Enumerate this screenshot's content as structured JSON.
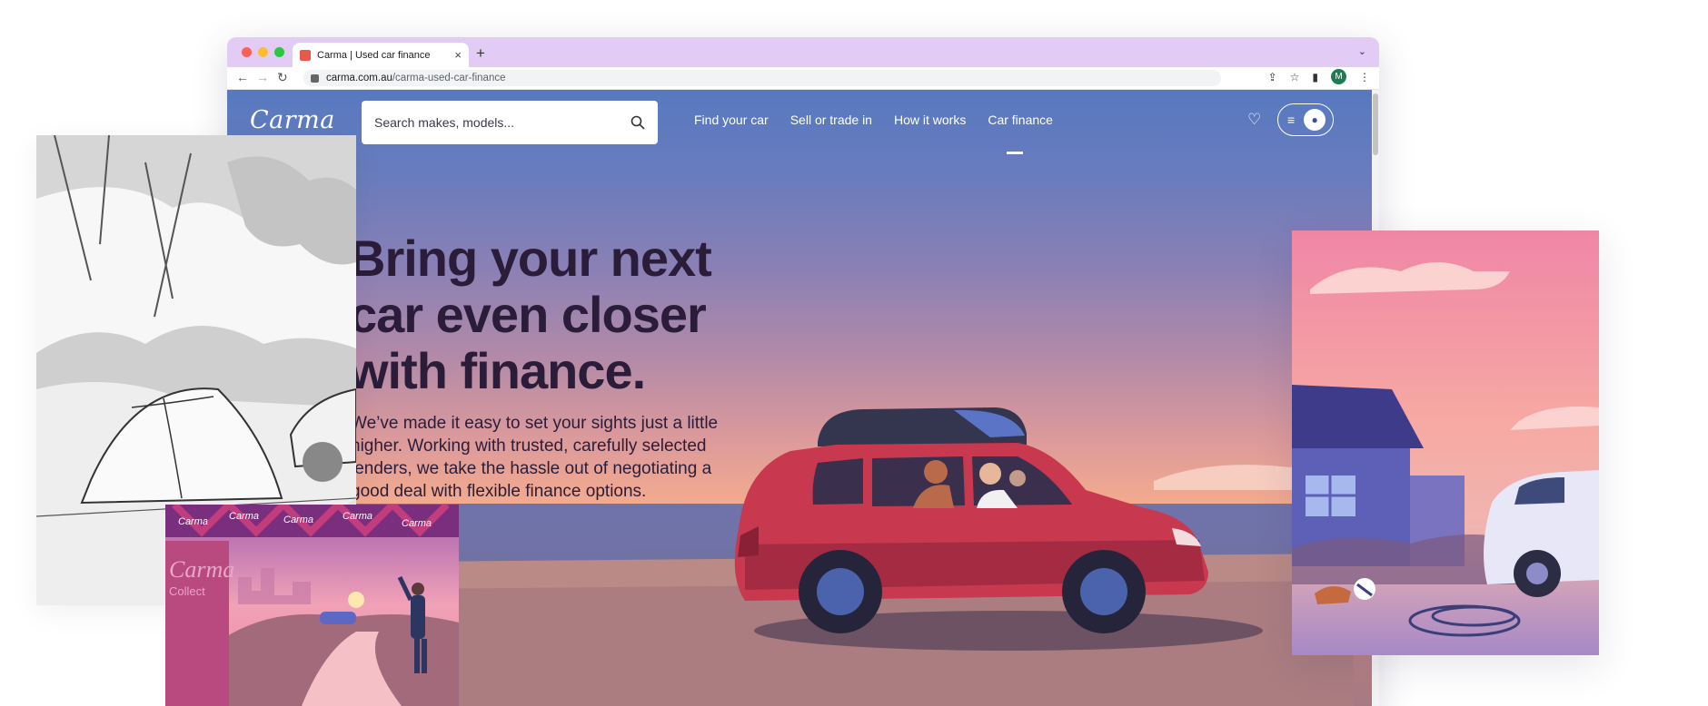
{
  "browser": {
    "tab_title": "Carma | Used car finance",
    "url_host": "carma.com.au",
    "url_path": "/carma-used-car-finance",
    "profile_initial": "M",
    "new_tab_label": "+",
    "tab_close_label": "×"
  },
  "site": {
    "logo": "Carma",
    "search_placeholder": "Search makes, models...",
    "nav": [
      "Find your car",
      "Sell or trade in",
      "How it works",
      "Car finance"
    ],
    "active_nav": "Car finance"
  },
  "hero": {
    "title_lines": [
      "Bring your next",
      "car even closer",
      "with finance."
    ],
    "body": "We’ve made it easy to set your sights just a little higher. Working with trusted, carefully selected lenders, we take the hassle out of negotiating a good deal with flexible finance options."
  },
  "illustrations": {
    "banner_text": [
      "Carma",
      "Carma",
      "Carma",
      "Carma",
      "Carma"
    ],
    "gate_sign": "Carma",
    "gate_sub": "Collect"
  },
  "colors": {
    "tabbar": "#e2ccf6",
    "hero_text": "#2b1d3a",
    "car_body": "#c8384e",
    "sky_top": "#5779c0",
    "sunset": "#f3ab8e"
  }
}
